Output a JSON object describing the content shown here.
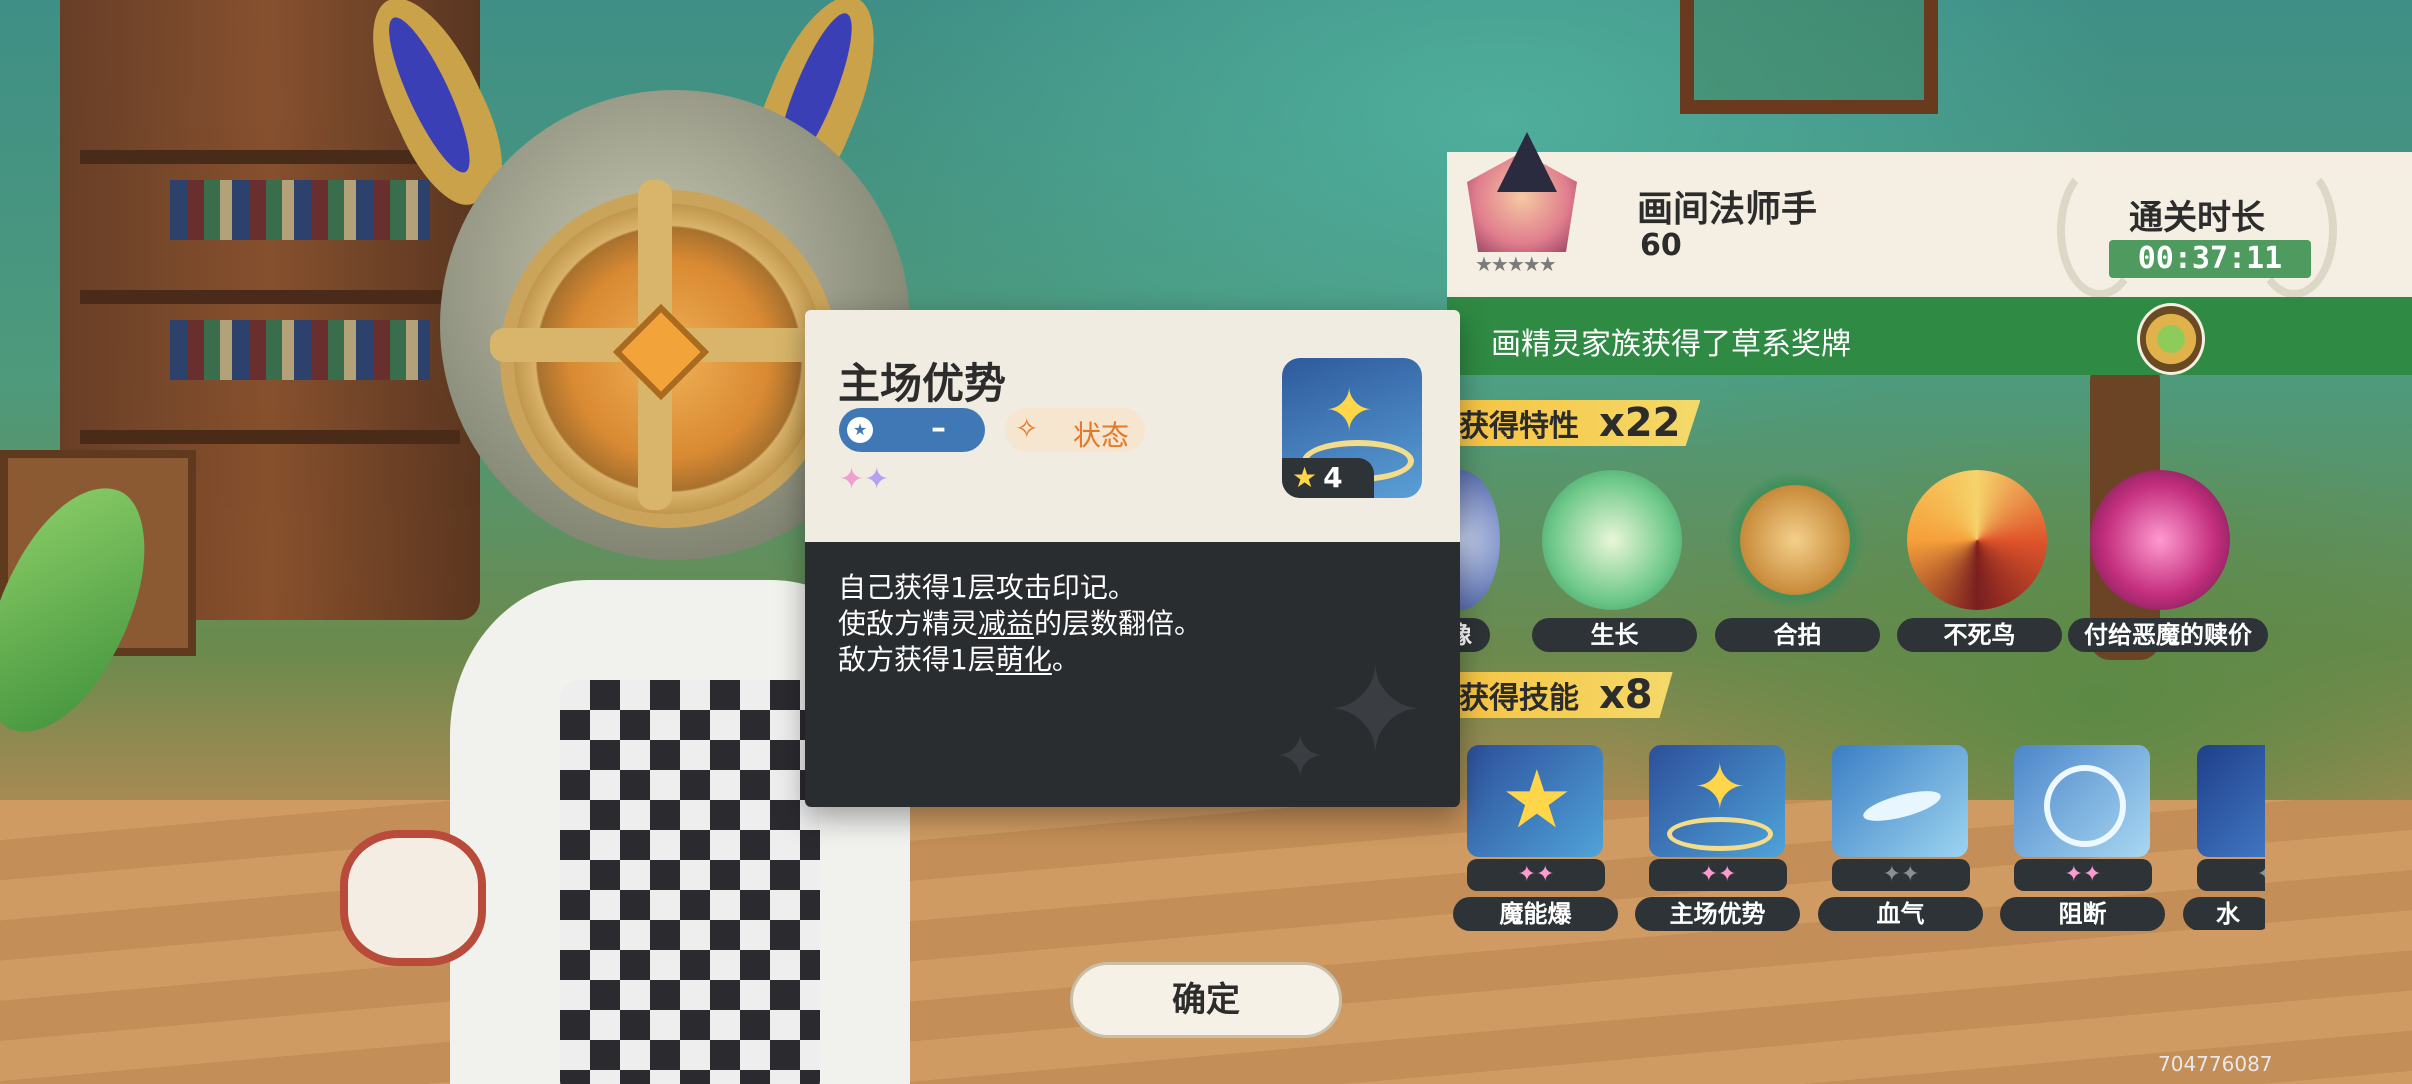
{
  "boss": {
    "name": "画间法师手",
    "level": "60",
    "stars": "★★★★★"
  },
  "clear_time": {
    "label": "通关时长",
    "value": "00:37:11"
  },
  "medal": {
    "text": "画精灵家族获得了草系奖牌",
    "icon": "grass-medal-icon"
  },
  "traits": {
    "title": "获得特性",
    "count": "x22",
    "items": [
      {
        "label": "像"
      },
      {
        "label": "生长"
      },
      {
        "label": "合拍"
      },
      {
        "label": "不死鸟"
      },
      {
        "label": "付给恶魔的赎价"
      }
    ]
  },
  "skills": {
    "title": "获得技能",
    "count": "x8",
    "items": [
      {
        "label": "魔能爆"
      },
      {
        "label": "主场优势"
      },
      {
        "label": "血气"
      },
      {
        "label": "阻断"
      },
      {
        "label": "水"
      }
    ]
  },
  "popup": {
    "title": "主场优势",
    "type_label": "–",
    "category_label": "状态",
    "cost": "4",
    "desc_line1": "自己获得1层攻击印记。",
    "desc_line2_a": "使敌方精灵",
    "desc_line2_b": "减益",
    "desc_line2_c": "的层数翻倍。",
    "desc_line3_a": "敌方获得1层",
    "desc_line3_b": "萌化",
    "desc_line3_c": "。"
  },
  "confirm_label": "确定",
  "uid": "704776087",
  "colors": {
    "accent_green": "#2f8a43",
    "time_bg": "#4e9a5f",
    "title_bar": "#f7c442",
    "type_blue": "#3f78b5",
    "status_orange": "#e27a2a"
  }
}
